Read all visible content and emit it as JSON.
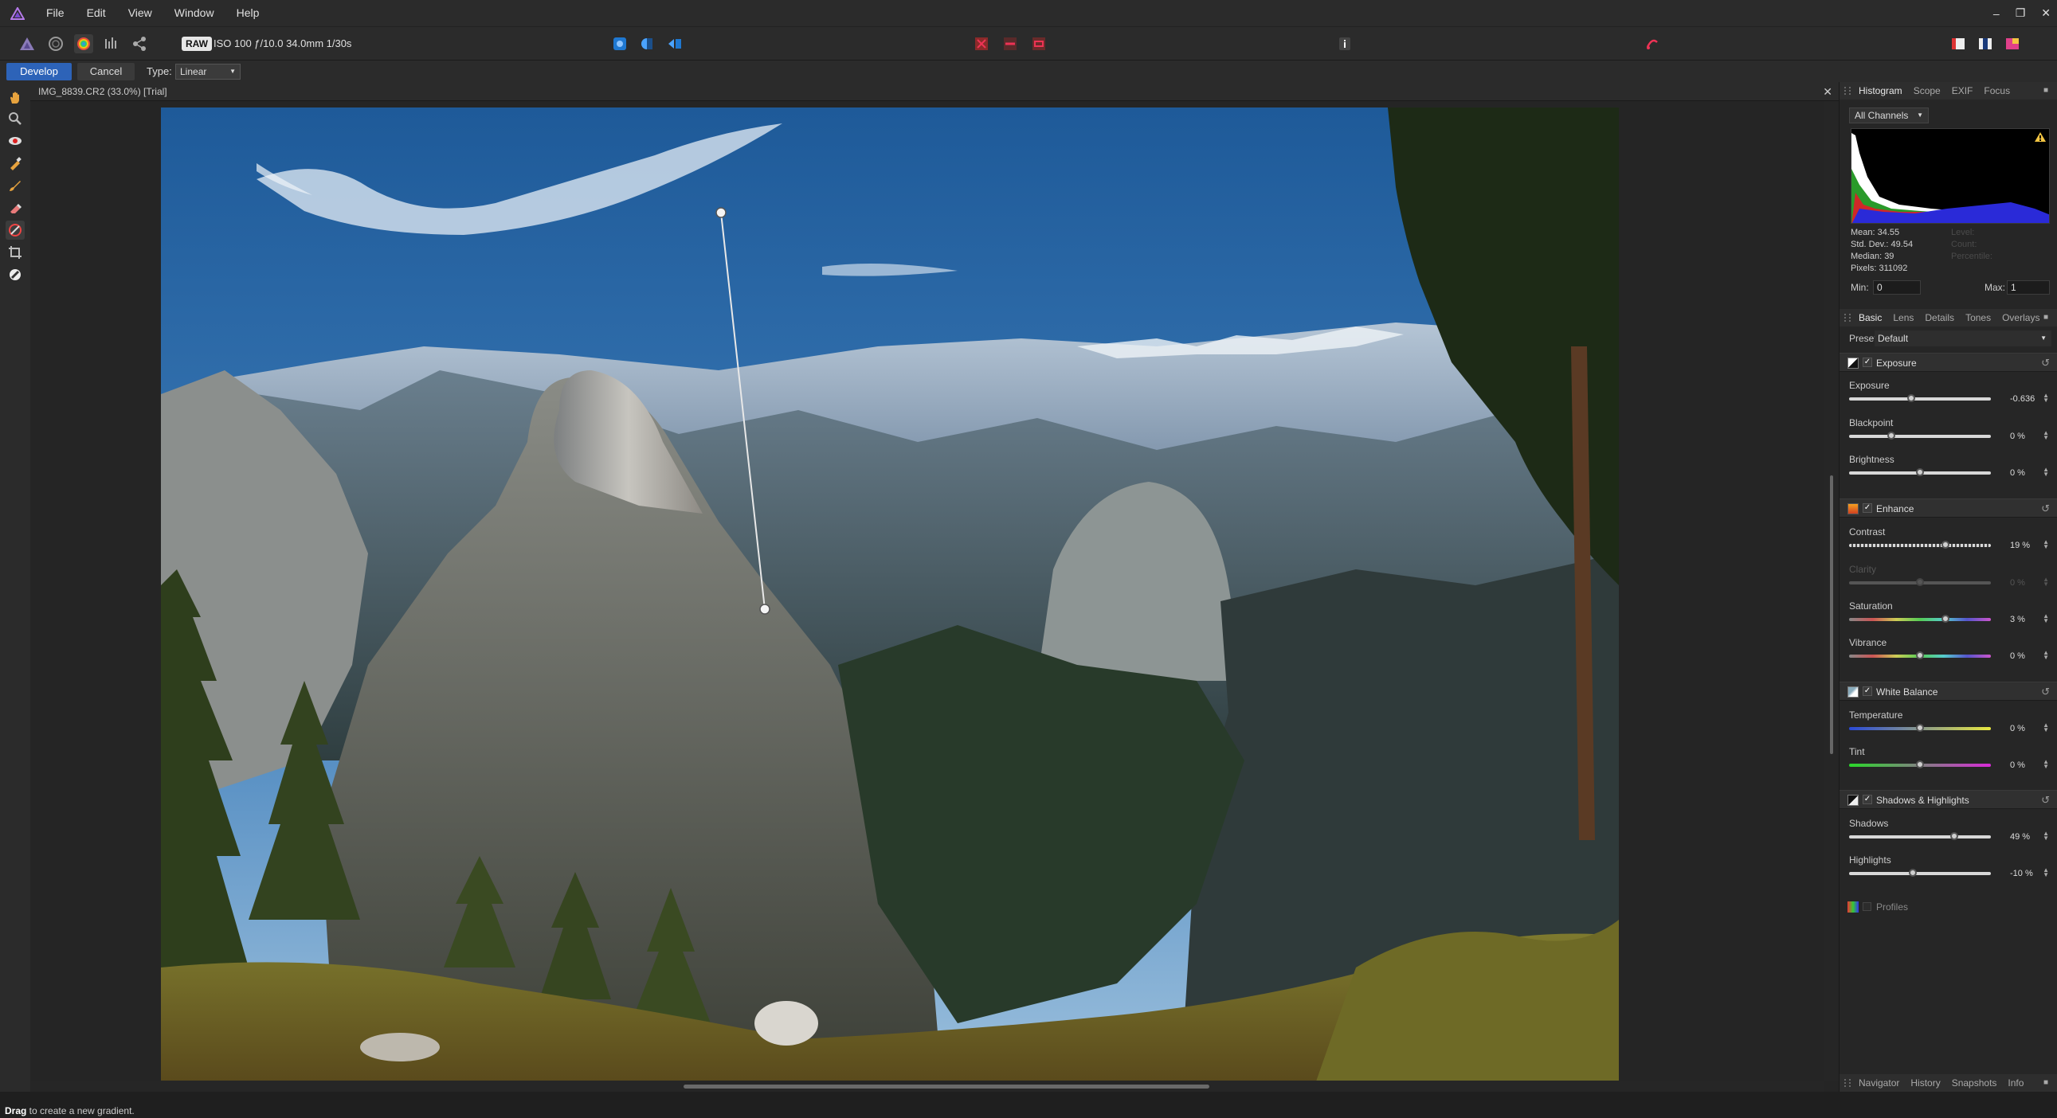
{
  "app": {
    "name": "Affinity Photo",
    "logo_icon": "affinity-triangle-icon"
  },
  "menu": {
    "file": "File",
    "edit": "Edit",
    "view": "View",
    "window": "Window",
    "help": "Help"
  },
  "window_controls": {
    "minimize": "–",
    "restore": "❐",
    "close": "✕"
  },
  "toolbar": {
    "raw_badge": "RAW",
    "photo_info": "ISO 100 ƒ/10.0 34.0mm 1/30s"
  },
  "context": {
    "develop_label": "Develop",
    "cancel_label": "Cancel",
    "type_label": "Type:",
    "type_value": "Linear"
  },
  "document": {
    "title": "IMG_8839.CR2 (33.0%) [Trial]",
    "close": "✕"
  },
  "histogram_panel": {
    "tabs": [
      "Histogram",
      "Scope",
      "EXIF",
      "Focus"
    ],
    "channels": "All Channels",
    "stats": {
      "mean": "Mean: 34.55",
      "std_dev": "Std. Dev.: 49.54",
      "median": "Median: 39",
      "pixels": "Pixels: 311092"
    },
    "stats_right": {
      "level": "Level:",
      "count": "Count:",
      "percentile": "Percentile:"
    },
    "min_label": "Min:",
    "min_value": "0",
    "max_label": "Max:",
    "max_value": "1"
  },
  "basic_panel": {
    "tabs": [
      "Basic",
      "Lens",
      "Details",
      "Tones",
      "Overlays"
    ],
    "preset_label": "Preset:",
    "preset_value": "Default",
    "sections": {
      "exposure": "Exposure",
      "enhance": "Enhance",
      "white_balance": "White Balance",
      "shadows_highlights": "Shadows & Highlights"
    },
    "adjustments": {
      "exposure": {
        "label": "Exposure",
        "value": "-0.636",
        "position": 0.44
      },
      "blackpoint": {
        "label": "Blackpoint",
        "value": "0 %",
        "position": 0.3
      },
      "brightness": {
        "label": "Brightness",
        "value": "0 %",
        "position": 0.5
      },
      "contrast": {
        "label": "Contrast",
        "value": "19 %",
        "position": 0.68
      },
      "clarity": {
        "label": "Clarity",
        "value": "0 %",
        "position": 0.5
      },
      "saturation": {
        "label": "Saturation",
        "value": "3 %",
        "position": 0.68
      },
      "vibrance": {
        "label": "Vibrance",
        "value": "0 %",
        "position": 0.5
      },
      "temperature": {
        "label": "Temperature",
        "value": "0 %",
        "position": 0.5
      },
      "tint": {
        "label": "Tint",
        "value": "0 %",
        "position": 0.5
      },
      "shadows": {
        "label": "Shadows",
        "value": "49 %",
        "position": 0.74
      },
      "highlights": {
        "label": "Highlights",
        "value": "-10 %",
        "position": 0.45
      }
    },
    "profiles": "Profiles"
  },
  "bottom_panel": {
    "tabs": [
      "Navigator",
      "History",
      "Snapshots",
      "Info"
    ]
  },
  "status": {
    "bold": "Drag",
    "text": " to create a new gradient."
  },
  "colors": {
    "accent": "#2d63b8",
    "panel": "#262626",
    "chrome": "#2b2b2b"
  }
}
